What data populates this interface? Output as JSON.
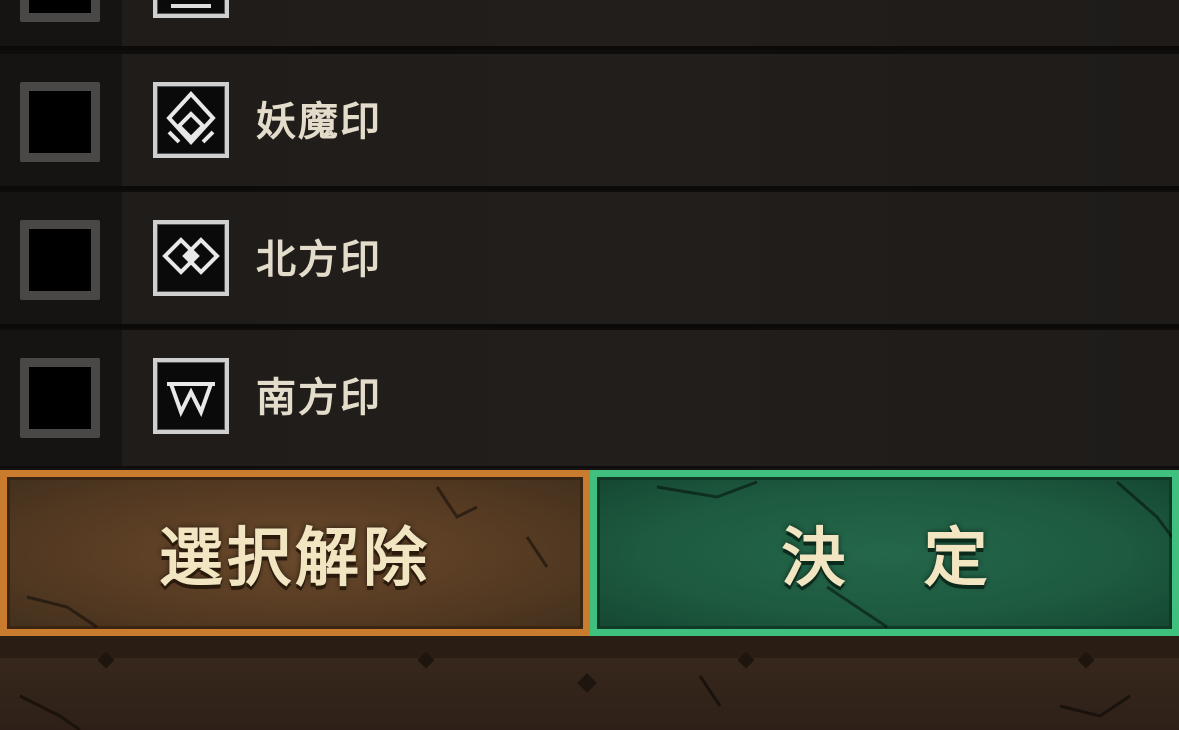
{
  "rows": [
    {
      "label": "妖魔印",
      "emblem": "yoma-seal-icon"
    },
    {
      "label": "北方印",
      "emblem": "north-seal-icon"
    },
    {
      "label": "南方印",
      "emblem": "south-seal-icon"
    }
  ],
  "buttons": {
    "clear_label": "選択解除",
    "confirm_label": "決 定"
  },
  "colors": {
    "clear_border": "#c97b2e",
    "confirm_border": "#3fc07e",
    "label_text": "#e4dccb"
  }
}
